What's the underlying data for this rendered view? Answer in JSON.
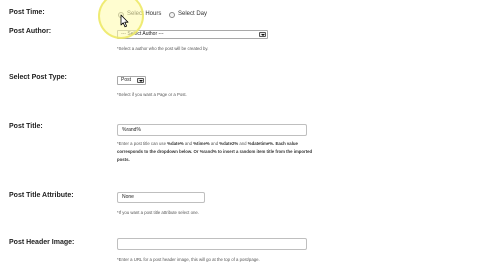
{
  "post_time": {
    "label": "Post Time:",
    "option_hours": "Select Hours",
    "option_day": "Select Day"
  },
  "post_author": {
    "label": "Post Author:",
    "value": "--- Select Author ---",
    "hint": "*Select a author who the post will be created by."
  },
  "post_type": {
    "label": "Select Post Type:",
    "value": "Post",
    "hint": "*Select if you want a Page or a Post."
  },
  "post_title": {
    "label": "Post Title:",
    "value": "%rand%",
    "hint": {
      "line1_a": "*Enter a post title can use",
      "tag1": "%date%",
      "and_1": "and",
      "tag2": "%time%",
      "and_2": "and",
      "tag3": "%date2%",
      "and_3": "and",
      "tag4": "%datetime%",
      "line1_b": ". Each value",
      "line2_a": "corresponds to the dropdown below. Or",
      "tag5": "%rand%",
      "line2_b": "to insert a random item title from the imported",
      "line3": "posts."
    }
  },
  "post_title_attribute": {
    "label": "Post Title Attribute:",
    "value": "None",
    "hint": "*If you want a post title attribute select one."
  },
  "post_header_image": {
    "label": "Post Header Image:",
    "value": "",
    "hint": "*Enter a URL for a post header image, this will go at the top of a post/page."
  },
  "colors": {
    "label_text": "#222222",
    "hint_text": "#555555",
    "halo": "#fffcaa"
  }
}
